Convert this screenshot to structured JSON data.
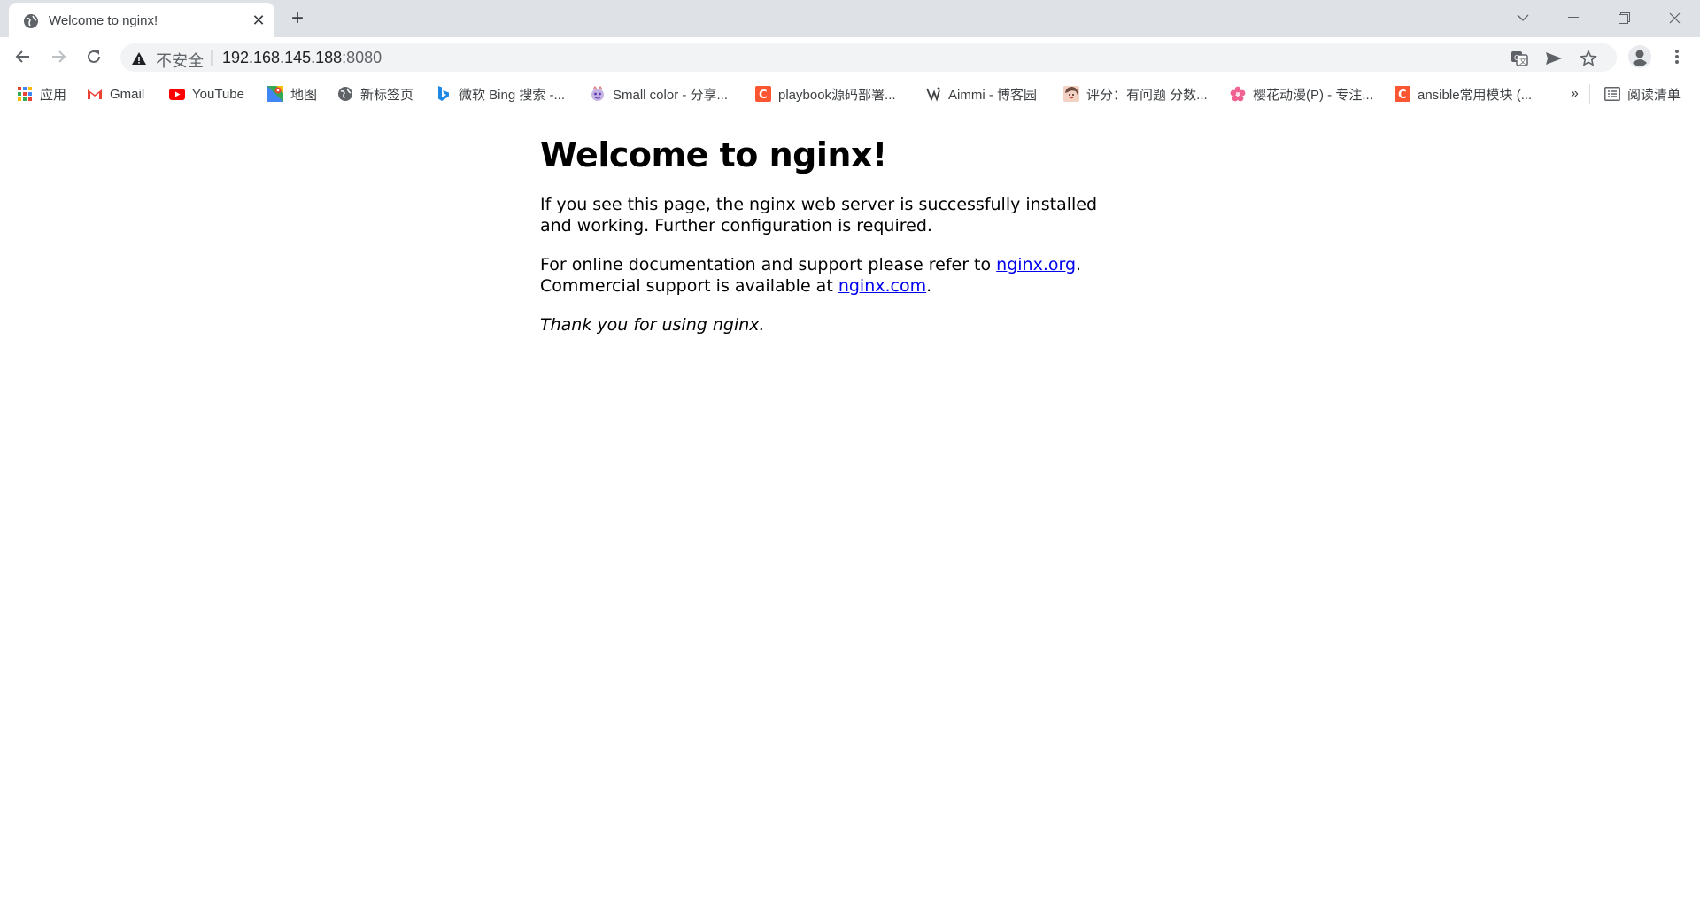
{
  "tab": {
    "title": "Welcome to nginx!",
    "favicon": "globe-icon"
  },
  "address": {
    "security_label": "不安全",
    "separator": "|",
    "host": "192.168.145.188",
    "port": ":8080"
  },
  "bookmarks": [
    {
      "label": "应用",
      "icon": "apps-grid-icon"
    },
    {
      "label": "Gmail",
      "icon": "gmail-icon"
    },
    {
      "label": "YouTube",
      "icon": "youtube-icon"
    },
    {
      "label": "地图",
      "icon": "maps-icon"
    },
    {
      "label": "新标签页",
      "icon": "globe-icon"
    },
    {
      "label": "微软 Bing 搜索 -...",
      "icon": "bing-icon"
    },
    {
      "label": "Small color - 分享...",
      "icon": "small-color-icon"
    },
    {
      "label": "playbook源码部署...",
      "icon": "csdn-icon"
    },
    {
      "label": "Aimmi - 博客园",
      "icon": "aimmi-icon"
    },
    {
      "label": "评分：有问题 分数...",
      "icon": "avatar-icon"
    },
    {
      "label": "樱花动漫(P) - 专注...",
      "icon": "sakura-icon"
    },
    {
      "label": "ansible常用模块 (...",
      "icon": "csdn-icon"
    }
  ],
  "bookmarks_overflow": "»",
  "reading_list": {
    "label": "阅读清单",
    "icon": "reading-list-icon"
  },
  "page": {
    "heading": "Welcome to nginx!",
    "para1": "If you see this page, the nginx web server is successfully installed and working. Further configuration is required.",
    "para2_text1": "For online documentation and support please refer to ",
    "para2_link1": "nginx.org",
    "para2_text2": ".",
    "para2_text3": "Commercial support is available at ",
    "para2_link2": "nginx.com",
    "para2_text4": ".",
    "thanks": "Thank you for using nginx."
  },
  "colors": {
    "link": "#0000ee",
    "tabstrip": "#dee1e6",
    "omnibox": "#f1f3f4",
    "csdn": "#fc5531",
    "youtube": "#ff0000"
  }
}
